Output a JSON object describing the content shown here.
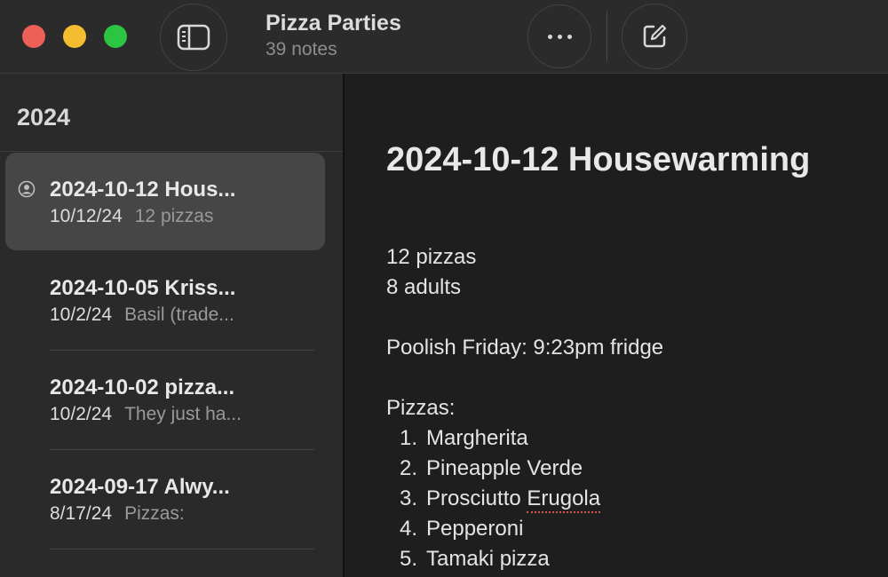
{
  "window": {
    "title": "Pizza Parties",
    "subtitle": "39 notes"
  },
  "sidebar": {
    "section_header": "2024",
    "notes": [
      {
        "title": "2024-10-12 Hous...",
        "date": "10/12/24",
        "preview": "12 pizzas",
        "selected": true,
        "shared": true
      },
      {
        "title": "2024-10-05 Kriss...",
        "date": "10/2/24",
        "preview": "Basil (trade...",
        "selected": false,
        "shared": false
      },
      {
        "title": "2024-10-02 pizza...",
        "date": "10/2/24",
        "preview": "They just ha...",
        "selected": false,
        "shared": false
      },
      {
        "title": "2024-09-17 Alwy...",
        "date": "8/17/24",
        "preview": "Pizzas:",
        "selected": false,
        "shared": false
      }
    ]
  },
  "note": {
    "title": "2024-10-12 Housewarming",
    "lines": [
      "12 pizzas",
      "8 adults",
      "Poolish Friday: 9:23pm fridge",
      "Pizzas:"
    ],
    "pizzas": [
      {
        "num": "1.",
        "text": "Margherita"
      },
      {
        "num": "2.",
        "text": "Pineapple Verde"
      },
      {
        "num": "3.",
        "text_a": "Prosciutto ",
        "text_b": "Erugola"
      },
      {
        "num": "4.",
        "text": "Pepperoni"
      },
      {
        "num": "5.",
        "text": "Tamaki pizza"
      }
    ]
  },
  "icons": {
    "sidebar_toggle": "sidebar-icon",
    "more": "ellipsis-icon",
    "compose": "compose-icon",
    "shared": "shared-person-icon"
  },
  "colors": {
    "close": "#ed5f57",
    "minimize": "#f4bc2f",
    "zoom": "#2cc543",
    "selection": "#464646",
    "spellcheck": "#d9534f"
  }
}
